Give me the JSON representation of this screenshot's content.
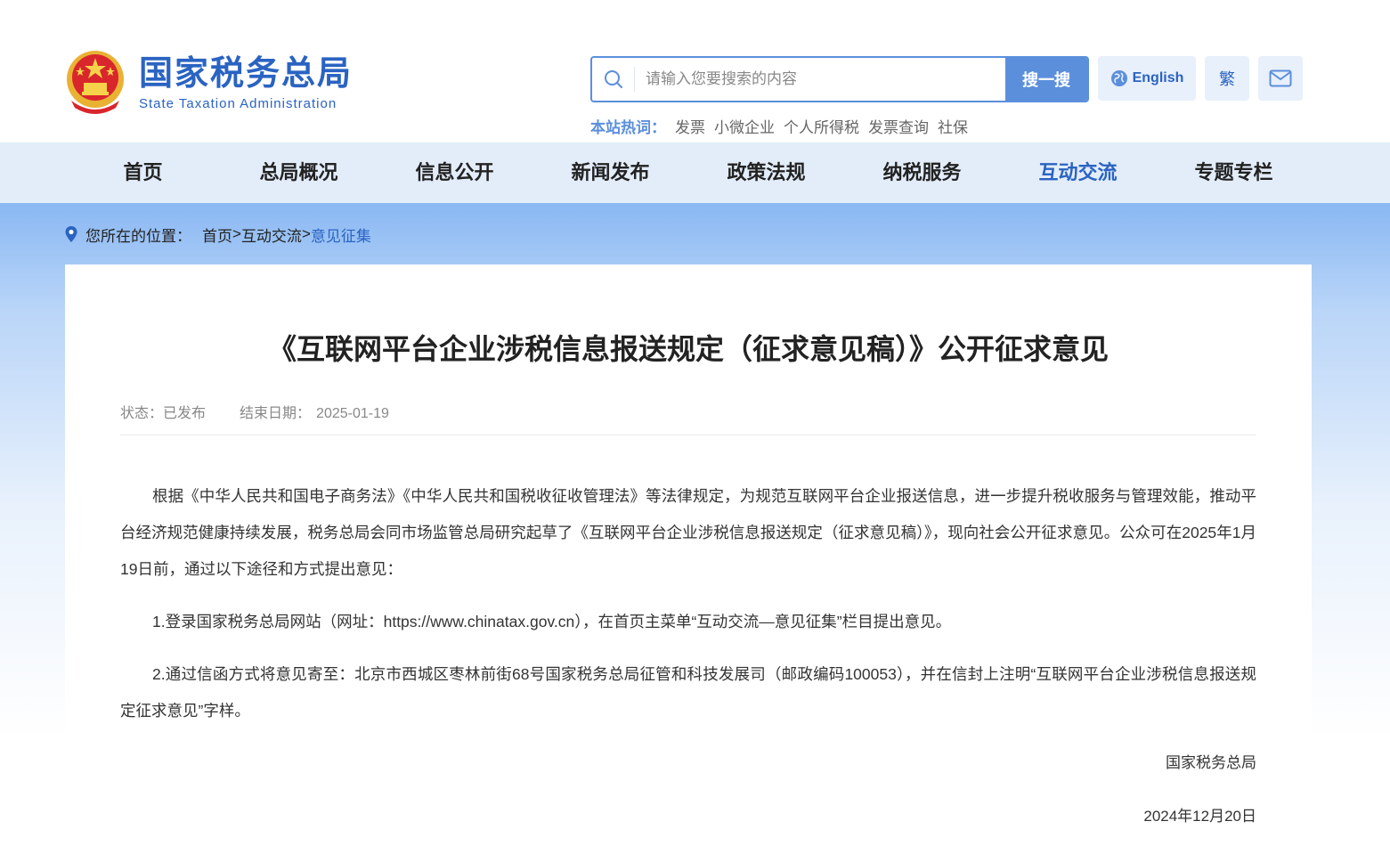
{
  "header": {
    "logo_cn": "国家税务总局",
    "logo_en": "State Taxation Administration",
    "search_placeholder": "请输入您要搜索的内容",
    "search_button": "搜一搜",
    "english_button": "English",
    "traditional_button": "繁",
    "hot_label": "本站热词：",
    "hot_words": [
      "发票",
      "小微企业",
      "个人所得税",
      "发票查询",
      "社保"
    ]
  },
  "nav": {
    "items": [
      "首页",
      "总局概况",
      "信息公开",
      "新闻发布",
      "政策法规",
      "纳税服务",
      "互动交流",
      "专题专栏"
    ],
    "active": "互动交流"
  },
  "breadcrumb": {
    "prefix": "您所在的位置：",
    "home": "首页",
    "sep1": ">",
    "section": "互动交流",
    "sep2": ">",
    "current": "意见征集"
  },
  "article": {
    "title": "《互联网平台企业涉税信息报送规定（征求意见稿）》公开征求意见",
    "status_label": "状态：",
    "status_value": "已发布",
    "end_label": "结束日期：",
    "end_value": "2025-01-19",
    "paragraphs": [
      "根据《中华人民共和国电子商务法》《中华人民共和国税收征收管理法》等法律规定，为规范互联网平台企业报送信息，进一步提升税收服务与管理效能，推动平台经济规范健康持续发展，税务总局会同市场监管总局研究起草了《互联网平台企业涉税信息报送规定（征求意见稿）》，现向社会公开征求意见。公众可在2025年1月19日前，通过以下途径和方式提出意见：",
      "1.登录国家税务总局网站（网址：https://www.chinatax.gov.cn），在首页主菜单“互动交流—意见征集”栏目提出意见。",
      "2.通过信函方式将意见寄至：北京市西城区枣林前街68号国家税务总局征管和科技发展司（邮政编码100053），并在信封上注明“互联网平台企业涉税信息报送规定征求意见”字样。"
    ],
    "signature": "国家税务总局",
    "date": "2024年12月20日"
  },
  "colors": {
    "brand_blue": "#2a63c2",
    "search_blue": "#5b8fdc",
    "nav_bg": "#e3edfa"
  }
}
